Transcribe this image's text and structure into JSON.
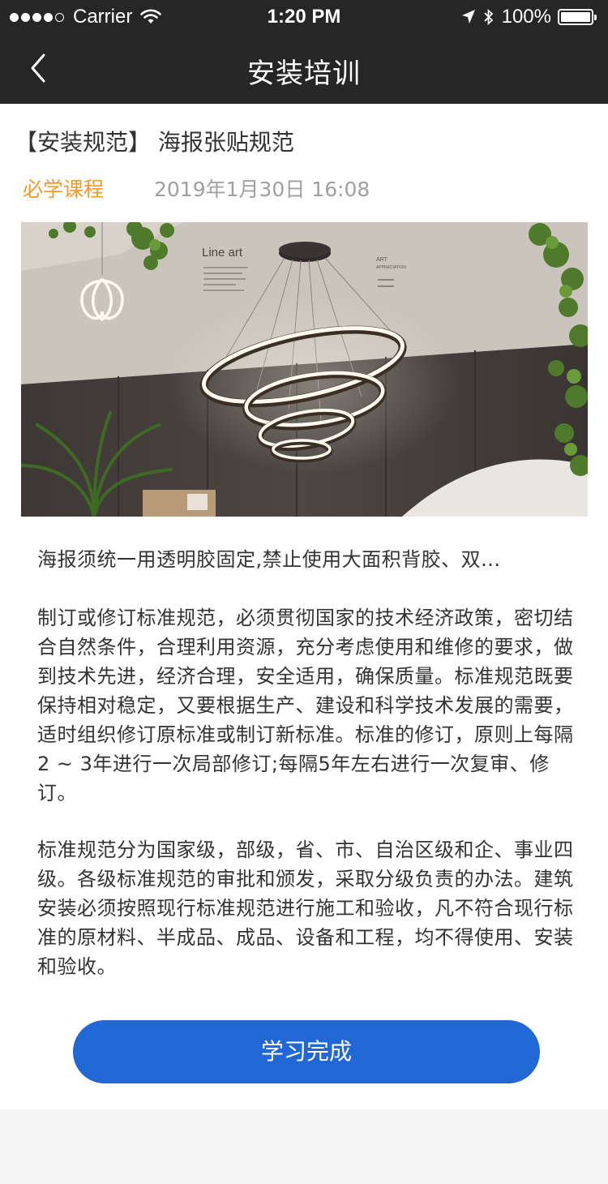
{
  "status_bar": {
    "carrier": "Carrier",
    "time": "1:20 PM",
    "battery": "100%",
    "battery_level": 1.0,
    "signal_bars_filled": 4,
    "signal_bars_total": 5
  },
  "nav": {
    "title": "安装培训",
    "back_icon": "chevron-left-icon"
  },
  "article": {
    "title": "【安装规范】 海报张贴规范",
    "tag": "必学课程",
    "date": "2019年1月30日 16:08",
    "image": {
      "brand_text": "Line art",
      "side_text": "ART APPRECIATION"
    },
    "summary": "海报须统一用透明胶固定,禁止使用大面积背胶、双...",
    "paragraph_1": "制订或修订标准规范，必须贯彻国家的技术经济政策，密切结合自然条件，合理利用资源，充分考虑使用和维修的要求，做到技术先进，经济合理，安全适用，确保质量。标准规范既要保持相对稳定，又要根据生产、建设和科学技术发展的需要，适时组织修订原标准或制订新标准。标准的修订，原则上每隔2 ~ 3年进行一次局部修订;每隔5年左右进行一次复审、修订。",
    "paragraph_2": "标准规范分为国家级，部级，省、市、自治区级和企、事业四级。各级标准规范的审批和颁发，采取分级负责的办法。建筑安装必须按照现行标准规范进行施工和验收，凡不符合现行标准的原材料、半成品、成品、设备和工程，均不得使用、安装和验收。"
  },
  "actions": {
    "complete_label": "学习完成"
  },
  "colors": {
    "header_bg": "#262626",
    "tag_orange": "#f39a2b",
    "date_gray": "#a0a0a0",
    "button_blue": "#2167d6"
  }
}
